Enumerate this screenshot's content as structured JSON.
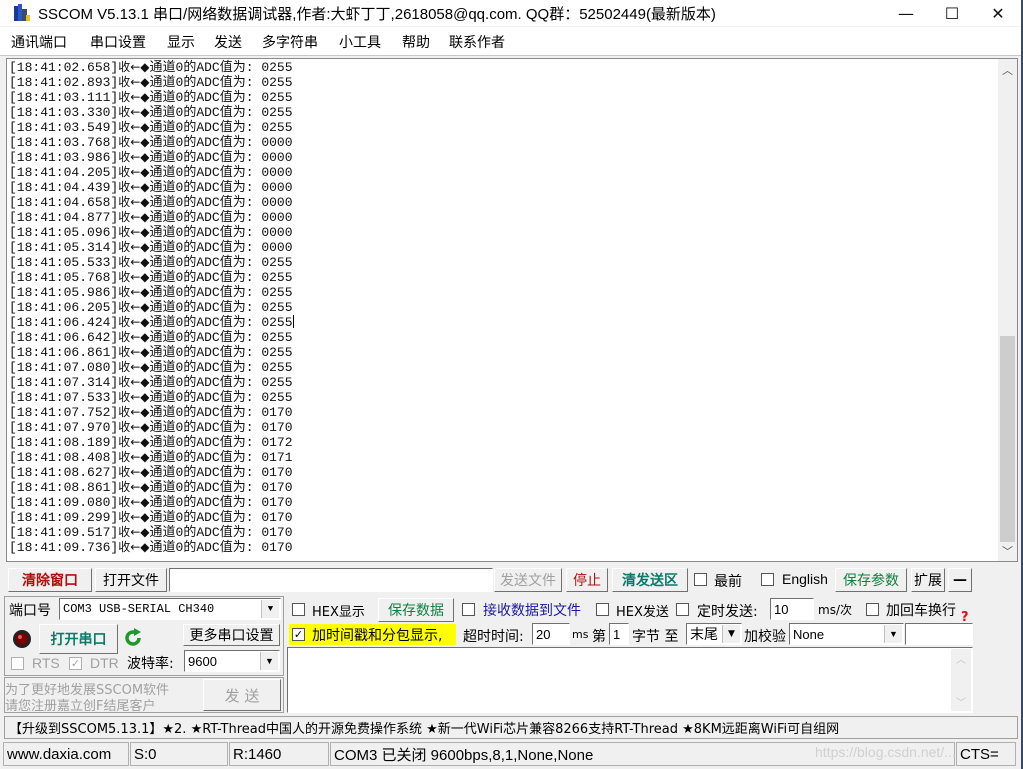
{
  "window": {
    "title": "SSCOM V5.13.1 串口/网络数据调试器,作者:大虾丁丁,2618058@qq.com. QQ群：52502449(最新版本)",
    "minimize": "—",
    "maximize": "☐",
    "close": "✕"
  },
  "menu": [
    "通讯端口",
    "串口设置",
    "显示",
    "发送",
    "多字符串",
    "小工具",
    "帮助",
    "联系作者"
  ],
  "receive": {
    "direction_label": "收←◆",
    "message_prefix": "通道0的ADC值为: ",
    "lines": [
      {
        "time": "[18:41:02.658]",
        "value": "0255"
      },
      {
        "time": "[18:41:02.893]",
        "value": "0255"
      },
      {
        "time": "[18:41:03.111]",
        "value": "0255"
      },
      {
        "time": "[18:41:03.330]",
        "value": "0255"
      },
      {
        "time": "[18:41:03.549]",
        "value": "0255"
      },
      {
        "time": "[18:41:03.768]",
        "value": "0000"
      },
      {
        "time": "[18:41:03.986]",
        "value": "0000"
      },
      {
        "time": "[18:41:04.205]",
        "value": "0000"
      },
      {
        "time": "[18:41:04.439]",
        "value": "0000"
      },
      {
        "time": "[18:41:04.658]",
        "value": "0000"
      },
      {
        "time": "[18:41:04.877]",
        "value": "0000"
      },
      {
        "time": "[18:41:05.096]",
        "value": "0000"
      },
      {
        "time": "[18:41:05.314]",
        "value": "0000"
      },
      {
        "time": "[18:41:05.533]",
        "value": "0255"
      },
      {
        "time": "[18:41:05.768]",
        "value": "0255"
      },
      {
        "time": "[18:41:05.986]",
        "value": "0255"
      },
      {
        "time": "[18:41:06.205]",
        "value": "0255"
      },
      {
        "time": "[18:41:06.424]",
        "value": "0255"
      },
      {
        "time": "[18:41:06.642]",
        "value": "0255"
      },
      {
        "time": "[18:41:06.861]",
        "value": "0255"
      },
      {
        "time": "[18:41:07.080]",
        "value": "0255"
      },
      {
        "time": "[18:41:07.314]",
        "value": "0255"
      },
      {
        "time": "[18:41:07.533]",
        "value": "0255"
      },
      {
        "time": "[18:41:07.752]",
        "value": "0170"
      },
      {
        "time": "[18:41:07.970]",
        "value": "0170"
      },
      {
        "time": "[18:41:08.189]",
        "value": "0172"
      },
      {
        "time": "[18:41:08.408]",
        "value": "0171"
      },
      {
        "time": "[18:41:08.627]",
        "value": "0170"
      },
      {
        "time": "[18:41:08.861]",
        "value": "0170"
      },
      {
        "time": "[18:41:09.080]",
        "value": "0170"
      },
      {
        "time": "[18:41:09.299]",
        "value": "0170"
      },
      {
        "time": "[18:41:09.517]",
        "value": "0170"
      },
      {
        "time": "[18:41:09.736]",
        "value": "0170"
      }
    ],
    "caret_line_index": 17
  },
  "toolbar": {
    "clear_window": "清除窗口",
    "open_file": "打开文件",
    "file_path": "",
    "send_file": "发送文件",
    "stop": "停止",
    "clear_send": "清发送区",
    "topmost": "最前",
    "topmost_checked": false,
    "english": "English",
    "english_checked": false,
    "save_params": "保存参数",
    "expand": "扩展",
    "collapse": "—"
  },
  "port": {
    "port_label": "端口号",
    "port_value": "COM3 USB-SERIAL CH340",
    "open_port": "打开串口",
    "more_settings": "更多串口设置",
    "rts": "RTS",
    "rts_checked": false,
    "dtr": "DTR",
    "dtr_checked": true,
    "baud_label": "波特率:",
    "baud_value": "9600",
    "promo_line1": "为了更好地发展SSCOM软件",
    "promo_line2": "请您注册嘉立创F结尾客户",
    "send": "发 送"
  },
  "options": {
    "hex_display": "HEX显示",
    "hex_display_checked": false,
    "save_data": "保存数据",
    "recv_to_file": "接收数据到文件",
    "recv_to_file_checked": false,
    "hex_send": "HEX发送",
    "hex_send_checked": false,
    "timed_send": "定时发送:",
    "timed_send_checked": false,
    "interval": "10",
    "interval_unit": "ms/次",
    "add_crlf": "加回车换行",
    "add_crlf_checked": false,
    "timestamp": "加时间戳和分包显示,",
    "timestamp_checked": true,
    "timeout_label": "超时时间:",
    "timeout_value": "20",
    "timeout_unit": "ms",
    "byte_from_label": "第",
    "byte_from": "1",
    "byte_unit": "字节 至",
    "byte_to": "末尾",
    "checksum_label": "加校验",
    "checksum_value": "None",
    "checksum_extra": "",
    "help": "?"
  },
  "send_text": "",
  "marquee": "【升级到SSCOM5.13.1】★2. ★RT-Thread中国人的开源免费操作系统 ★新一代WiFi芯片兼容8266支持RT-Thread ★8KM远距离WiFi可自组网",
  "statusbar": {
    "website": "www.daxia.com",
    "sent": "S:0",
    "received": "R:1460",
    "port_status": "COM3 已关闭  9600bps,8,1,None,None",
    "cts": "CTS="
  },
  "watermark": "https://blog.csdn.net/...",
  "colors": {
    "highlight_yellow": "#ffff00",
    "clear_red": "#b01010",
    "save_green": "#108040",
    "open_teal": "#0a7a6a",
    "link_blue": "#1a1aa0"
  }
}
